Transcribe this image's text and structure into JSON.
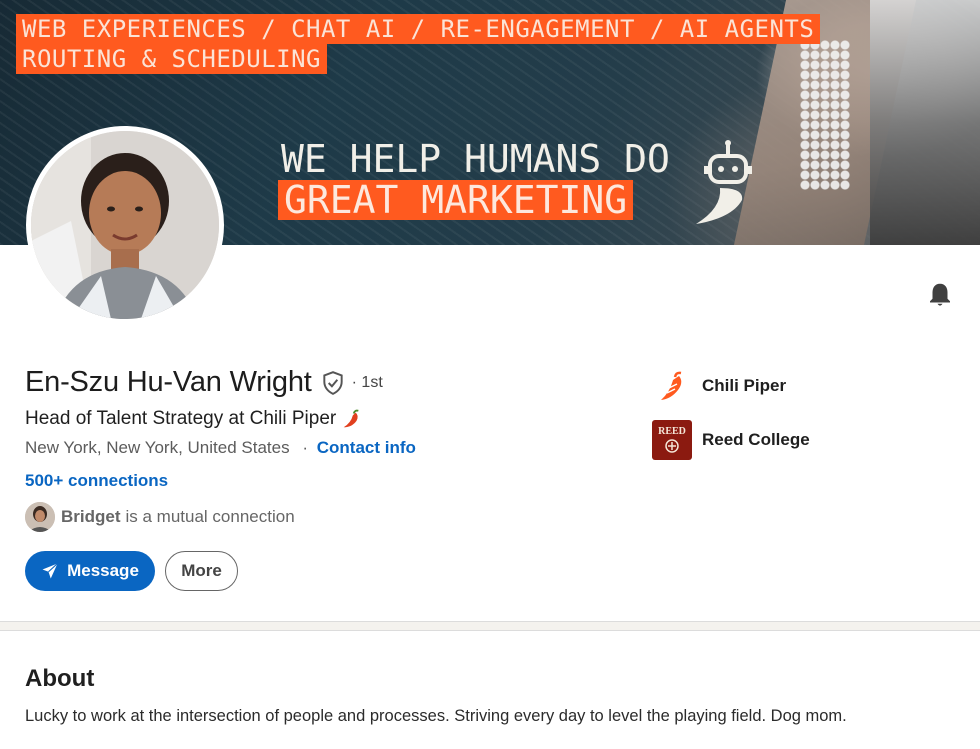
{
  "banner": {
    "tag_line1": "WEB EXPERIENCES / CHAT AI / RE-ENGAGEMENT / AI AGENTS",
    "tag_line2": "ROUTING & SCHEDULING",
    "headline": "WE HELP HUMANS DO",
    "highlight": "GREAT MARKETING",
    "brand_color": "#ff5a1f"
  },
  "profile": {
    "name": "En-Szu Hu-Van Wright",
    "degree": "· 1st",
    "headline": "Head of Talent Strategy at Chili Piper",
    "location": "New York, New York, United States",
    "separator": "·",
    "contact_info": "Contact info",
    "connections": "500+ connections",
    "mutual_name": "Bridget",
    "mutual_text": "is a mutual connection"
  },
  "actions": {
    "message_label": "Message",
    "more_label": "More"
  },
  "orgs": {
    "company": "Chili Piper",
    "school": "Reed College",
    "school_logo_text": "REED"
  },
  "about": {
    "title": "About",
    "text": "Lucky to work at the intersection of people and processes. Striving every day to level the playing field. Dog mom."
  },
  "colors": {
    "link": "#0a66c2",
    "primary_button": "#0a66c2",
    "reed": "#8b1a10"
  },
  "icons": [
    "bell-icon",
    "verified-shield-icon",
    "pepper-emoji-icon",
    "send-icon",
    "chili-piper-logo-icon",
    "reed-college-logo-icon"
  ]
}
